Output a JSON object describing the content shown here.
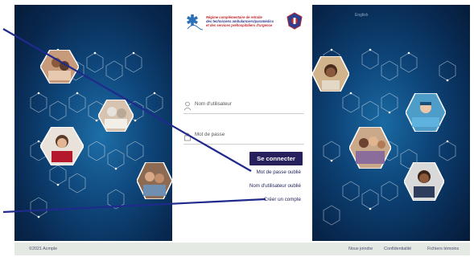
{
  "organization": {
    "name_lines": [
      "Régime complémentaire de retraite",
      "des techniciens ambulanciers/paramédics",
      "et des services préhospitaliers d'urgence",
      ""
    ]
  },
  "header": {
    "language_toggle": "English"
  },
  "login": {
    "username_label": "Nom d'utilisateur",
    "password_label": "Mot de passe",
    "submit_label": "Se connecter",
    "forgot_password": "Mot de passe oublié",
    "forgot_username": "Nom d'utilisateur oublié",
    "create_account": "Créer un compte"
  },
  "footer": {
    "copyright": "©2021 Acmple",
    "links": [
      "Nous joindre",
      "Confidentialité",
      "Fichiers témoins"
    ]
  },
  "colors": {
    "primary_button": "#26205c",
    "link_text": "#1b1f56",
    "background_dark": "#082a52",
    "annotation_arrow": "#1f2a8c",
    "footer_bg": "#e4e9e4"
  },
  "icons": {
    "user_field": "user-icon",
    "password_field": "lock-icon",
    "logo": "star-of-life-icon",
    "badge": "badge-icon"
  }
}
